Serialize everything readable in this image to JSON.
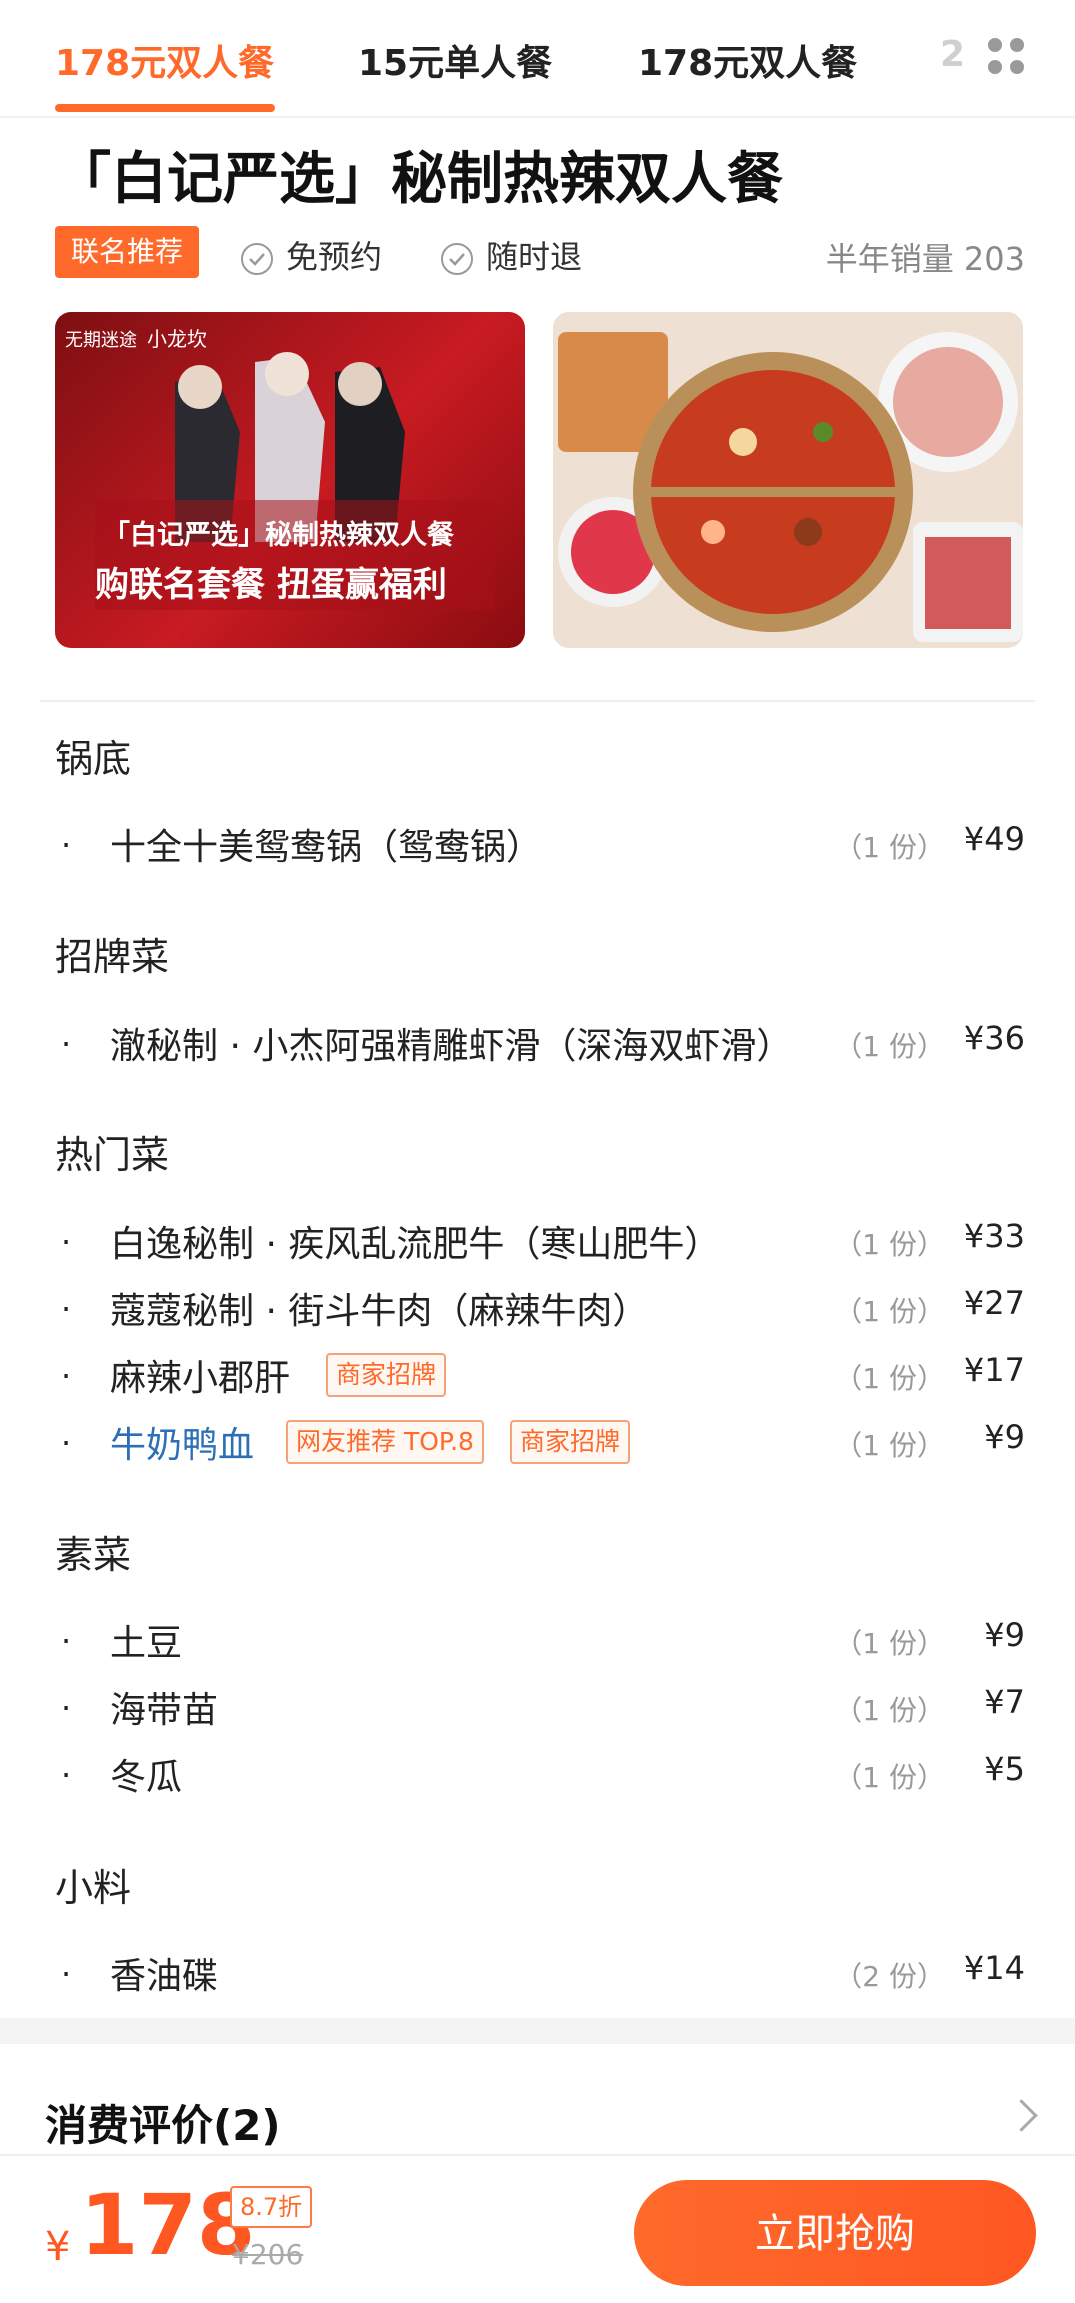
{
  "tabs": [
    "178元双人餐",
    "15元单人餐",
    "178元双人餐",
    "2"
  ],
  "title": "「白记严选」秘制热辣双人餐",
  "badge": "联名推荐",
  "features": [
    "免预约",
    "随时退"
  ],
  "sales": "半年销量 203",
  "promo_image": {
    "logo_left": "无期迷途",
    "logo_right": "小龙坎",
    "line1": "「白记严选」秘制热辣双人餐",
    "line2": "购联名套餐 扭蛋赢福利"
  },
  "sections": [
    {
      "title": "锅底",
      "items": [
        {
          "name": "十全十美鸳鸯锅（鸳鸯锅）",
          "qty": "（1 份）",
          "price": "¥49"
        }
      ]
    },
    {
      "title": "招牌菜",
      "items": [
        {
          "name": "澈秘制 · 小杰阿强精雕虾滑（深海双虾滑）",
          "qty": "（1 份）",
          "price": "¥36"
        }
      ]
    },
    {
      "title": "热门菜",
      "items": [
        {
          "name": "白逸秘制 · 疾风乱流肥牛（寒山肥牛）",
          "qty": "（1 份）",
          "price": "¥33"
        },
        {
          "name": "蔻蔻秘制 · 街斗牛肉（麻辣牛肉）",
          "qty": "（1 份）",
          "price": "¥27"
        },
        {
          "name": "麻辣小郡肝",
          "qty": "（1 份）",
          "price": "¥17",
          "tags": [
            "商家招牌"
          ]
        },
        {
          "name": "牛奶鸭血",
          "qty": "（1 份）",
          "price": "¥9",
          "tags": [
            "网友推荐 TOP.8",
            "商家招牌"
          ],
          "highlight_color": "#2d6fb5"
        }
      ]
    },
    {
      "title": "素菜",
      "items": [
        {
          "name": "土豆",
          "qty": "（1 份）",
          "price": "¥9"
        },
        {
          "name": "海带苗",
          "qty": "（1 份）",
          "price": "¥7"
        },
        {
          "name": "冬瓜",
          "qty": "（1 份）",
          "price": "¥5"
        }
      ]
    },
    {
      "title": "小料",
      "items": [
        {
          "name": "香油碟",
          "qty": "（2 份）",
          "price": "¥14"
        }
      ]
    }
  ],
  "reviews_title": "消费评价(2)",
  "bottom": {
    "currency": "¥",
    "price": "178",
    "discount": "8.7折",
    "original_price": "¥206",
    "buy_label": "立即抢购"
  },
  "colors": {
    "accent": "#ff6a2b",
    "price": "#ff5722",
    "link": "#2d6fb5"
  }
}
